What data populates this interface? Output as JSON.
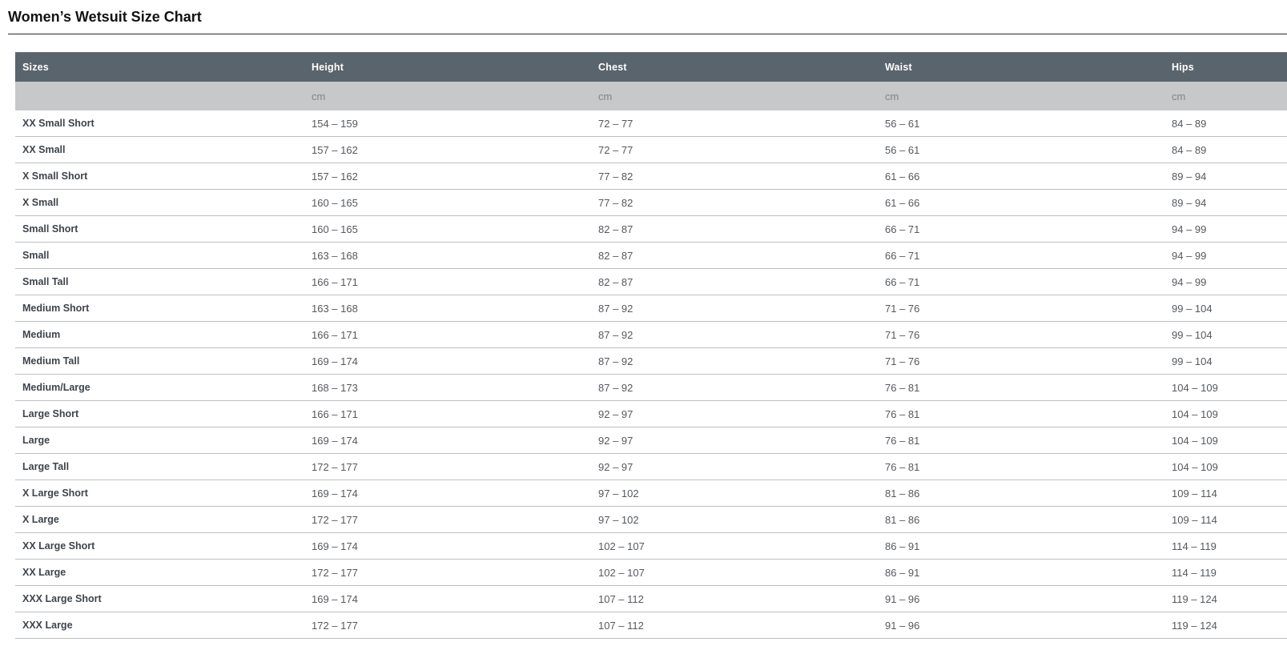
{
  "page": {
    "title": "Women’s Wetsuit Size Chart"
  },
  "table": {
    "columns": [
      "Sizes",
      "Height",
      "Chest",
      "Waist",
      "Hips"
    ],
    "units": [
      "",
      "cm",
      "cm",
      "cm",
      "cm"
    ],
    "rows": [
      [
        "XX Small Short",
        "154 – 159",
        "72 – 77",
        "56 – 61",
        "84 – 89"
      ],
      [
        "XX Small",
        "157 – 162",
        "72 – 77",
        "56 – 61",
        "84 – 89"
      ],
      [
        "X Small Short",
        "157 – 162",
        "77 – 82",
        "61 – 66",
        "89 – 94"
      ],
      [
        "X Small",
        "160 – 165",
        "77 – 82",
        "61 – 66",
        "89 – 94"
      ],
      [
        "Small Short",
        "160 – 165",
        "82 – 87",
        "66 – 71",
        "94 – 99"
      ],
      [
        "Small",
        "163 – 168",
        "82 – 87",
        "66 – 71",
        "94 – 99"
      ],
      [
        "Small Tall",
        "166 – 171",
        "82 – 87",
        "66 – 71",
        "94 – 99"
      ],
      [
        "Medium Short",
        "163 – 168",
        "87 – 92",
        "71 – 76",
        "99 – 104"
      ],
      [
        "Medium",
        "166 – 171",
        "87 – 92",
        "71 – 76",
        "99 – 104"
      ],
      [
        "Medium Tall",
        "169 – 174",
        "87 – 92",
        "71 – 76",
        "99 – 104"
      ],
      [
        "Medium/Large",
        "168 – 173",
        "87 – 92",
        "76 – 81",
        "104 – 109"
      ],
      [
        "Large Short",
        "166 – 171",
        "92 – 97",
        "76 – 81",
        "104 – 109"
      ],
      [
        "Large",
        "169 – 174",
        "92 – 97",
        "76 – 81",
        "104 – 109"
      ],
      [
        "Large Tall",
        "172 – 177",
        "92 – 97",
        "76 – 81",
        "104 – 109"
      ],
      [
        "X Large Short",
        "169 – 174",
        "97 – 102",
        "81 – 86",
        "109 – 114"
      ],
      [
        "X Large",
        "172 – 177",
        "97 – 102",
        "81 – 86",
        "109 – 114"
      ],
      [
        "XX Large Short",
        "169 – 174",
        "102 – 107",
        "86 – 91",
        "114 – 119"
      ],
      [
        "XX Large",
        "172 – 177",
        "102 – 107",
        "86 – 91",
        "114 – 119"
      ],
      [
        "XXX Large Short",
        "169 – 174",
        "107 – 112",
        "91 – 96",
        "119 – 124"
      ],
      [
        "XXX Large",
        "172 – 177",
        "107 – 112",
        "91 – 96",
        "119 – 124"
      ]
    ]
  },
  "colors": {
    "header_bg": "#5a646d",
    "header_text": "#ffffff",
    "units_bg": "#c7c8c9",
    "units_text": "#7f8488",
    "size_label_text": "#3e444b",
    "value_text": "#54595f",
    "row_border": "#bcbfc1",
    "title_text": "#131313",
    "title_rule": "#2b2b2b"
  }
}
